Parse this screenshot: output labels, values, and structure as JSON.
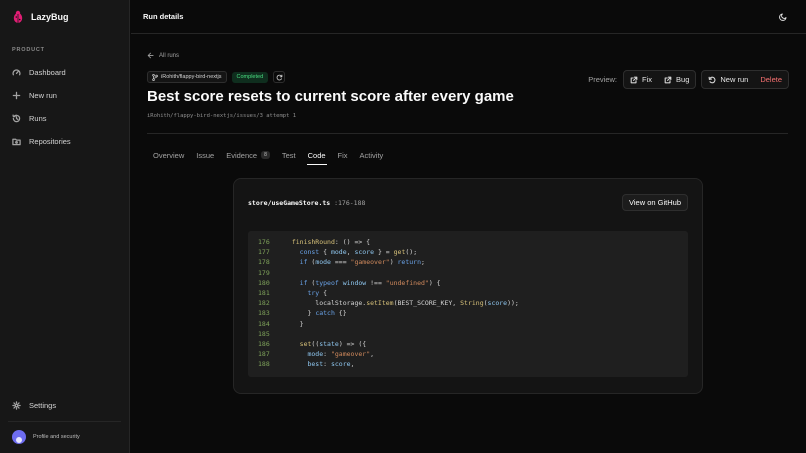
{
  "app": {
    "name": "LazyBug"
  },
  "sidebar": {
    "section_label": "PRODUCT",
    "items": [
      {
        "label": "Dashboard",
        "icon": "dashboard-icon"
      },
      {
        "label": "New run",
        "icon": "plus-icon"
      },
      {
        "label": "Runs",
        "icon": "history-icon"
      },
      {
        "label": "Repositories",
        "icon": "folder-git-icon"
      }
    ],
    "settings_label": "Settings",
    "profile_label": "Profile and security"
  },
  "header": {
    "title": "Run details"
  },
  "run": {
    "back_label": "All runs",
    "repo": "iRohith/flappy-bird-nextjs",
    "status": "Completed",
    "title": "Best score resets to current score after every game",
    "subtitle": "iRohith/flappy-bird-nextjs/issues/3 attempt 1"
  },
  "actions": {
    "preview_label": "Preview:",
    "fix_label": "Fix",
    "bug_label": "Bug",
    "new_run_label": "New run",
    "delete_label": "Delete"
  },
  "tabs": [
    {
      "label": "Overview"
    },
    {
      "label": "Issue"
    },
    {
      "label": "Evidence",
      "count": "8"
    },
    {
      "label": "Test"
    },
    {
      "label": "Code",
      "active": true
    },
    {
      "label": "Fix"
    },
    {
      "label": "Activity"
    }
  ],
  "code_view": {
    "file": "store/useGameStore.ts",
    "range": ":176-188",
    "github_label": "View on GitHub",
    "lines": [
      {
        "n": "176",
        "text": "  finishRound: () => {"
      },
      {
        "n": "177",
        "text": "    const { mode, score } = get();"
      },
      {
        "n": "178",
        "text": "    if (mode === \"gameover\") return;"
      },
      {
        "n": "179",
        "text": ""
      },
      {
        "n": "180",
        "text": "    if (typeof window !== \"undefined\") {"
      },
      {
        "n": "181",
        "text": "      try {"
      },
      {
        "n": "182",
        "text": "        localStorage.setItem(BEST_SCORE_KEY, String(score));"
      },
      {
        "n": "183",
        "text": "      } catch {}"
      },
      {
        "n": "184",
        "text": "    }"
      },
      {
        "n": "185",
        "text": ""
      },
      {
        "n": "186",
        "text": "    set((state) => ({"
      },
      {
        "n": "187",
        "text": "      mode: \"gameover\","
      },
      {
        "n": "188",
        "text": "      best: score,"
      }
    ]
  }
}
